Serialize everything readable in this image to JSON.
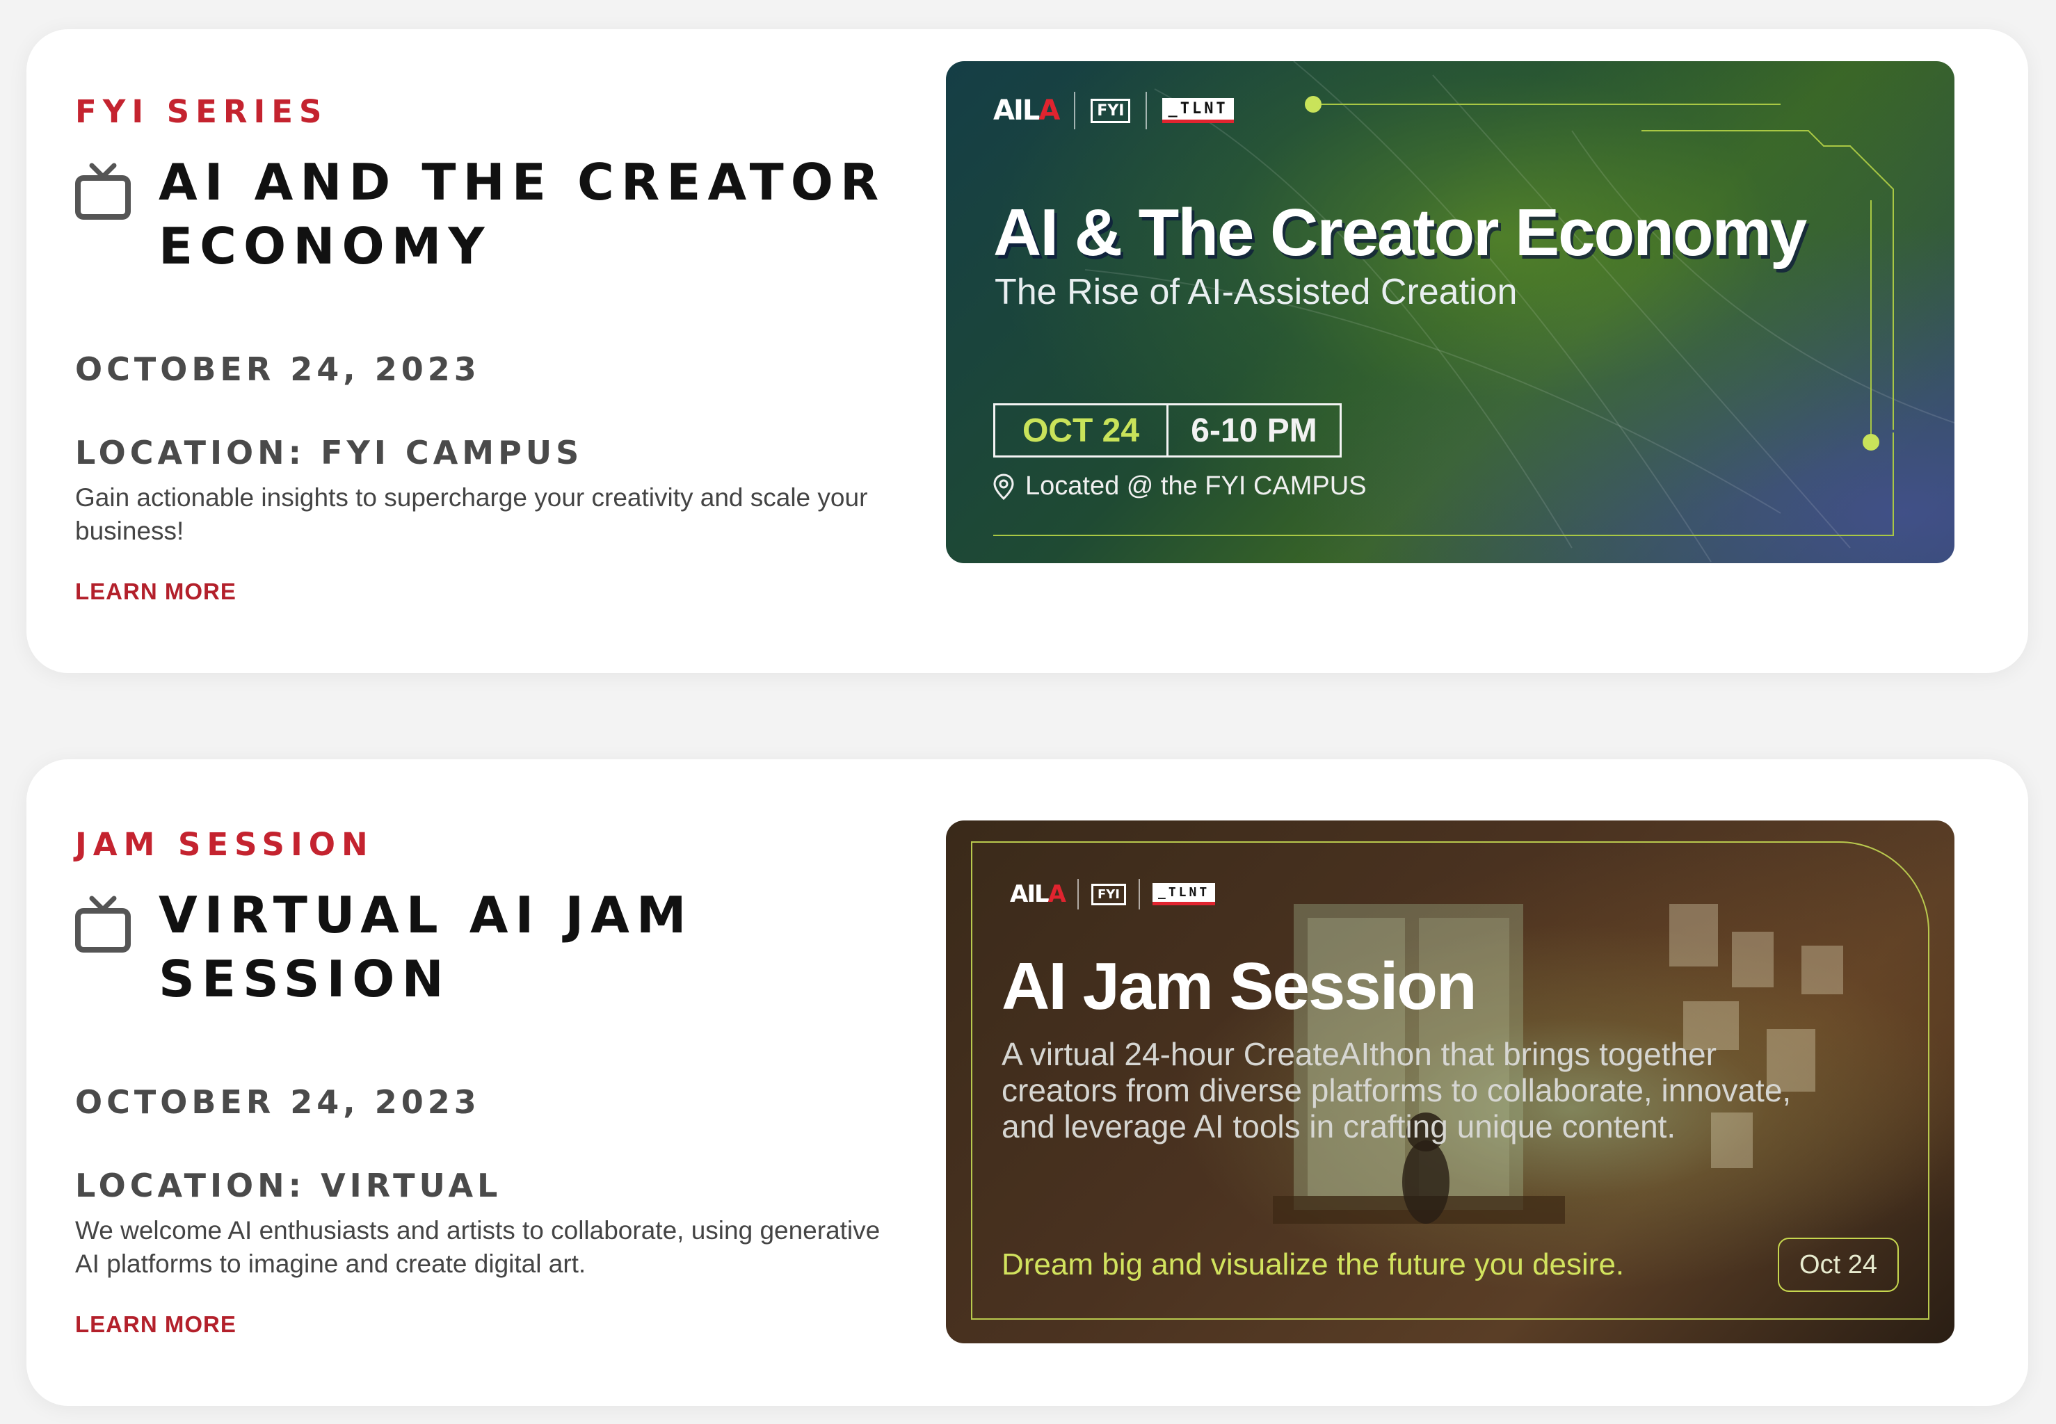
{
  "events": [
    {
      "series": "FYI SERIES",
      "title": "AI AND THE CREATOR ECONOMY",
      "date": "OCTOBER 24, 2023",
      "location": "LOCATION: FYI CAMPUS",
      "description": "Gain actionable insights to supercharge your creativity and scale your business!",
      "learn_more": "LEARN MORE",
      "banner": {
        "logo_aila": "AIL",
        "logo_aila_red": "A",
        "logo_fyi": "FYI",
        "logo_tlnt": "_TLNT",
        "title": "AI & The Creator Economy",
        "subtitle": "The Rise of AI-Assisted Creation",
        "date": "OCT 24",
        "time": "6-10 PM",
        "location": "Located @ the FYI CAMPUS"
      }
    },
    {
      "series": "JAM SESSION",
      "title": "VIRTUAL AI JAM SESSION",
      "date": "OCTOBER 24, 2023",
      "location": "LOCATION: VIRTUAL",
      "description": "We welcome AI enthusiasts and artists to collaborate, using generative AI platforms to imagine and create digital art.",
      "learn_more": "LEARN MORE",
      "banner": {
        "logo_aila": "AIL",
        "logo_aila_red": "A",
        "logo_fyi": "FYI",
        "logo_tlnt": "_TLNT",
        "title": "AI Jam Session",
        "description": "A virtual 24-hour CreateAIthon that brings together creators from diverse platforms to collaborate, innovate, and leverage AI tools in crafting unique content.",
        "tagline": "Dream big and visualize the future you desire.",
        "date": "Oct 24"
      }
    }
  ],
  "colors": {
    "accent_red": "#c4232f",
    "accent_lime": "#c9e35a"
  }
}
